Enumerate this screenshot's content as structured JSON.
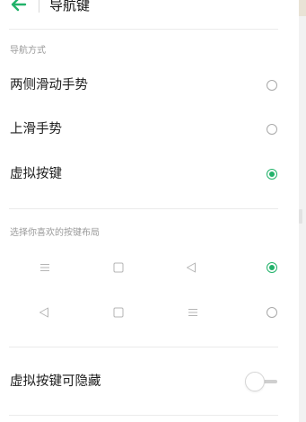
{
  "colors": {
    "accent": "#22b26a",
    "divider": "#ebebeb",
    "muted": "#9a9a9a"
  },
  "header": {
    "title": "导航键",
    "back_icon": "arrow-left-icon"
  },
  "navigation_mode": {
    "section_label": "导航方式",
    "options": [
      {
        "label": "两侧滑动手势",
        "selected": false
      },
      {
        "label": "上滑手势",
        "selected": false
      },
      {
        "label": "虚拟按键",
        "selected": true
      }
    ]
  },
  "layout": {
    "section_label": "选择你喜欢的按键布局",
    "options": [
      {
        "icons": [
          "menu-icon",
          "square-icon",
          "back-triangle-icon"
        ],
        "selected": true
      },
      {
        "icons": [
          "back-triangle-icon",
          "square-icon",
          "menu-icon"
        ],
        "selected": false
      }
    ]
  },
  "hide_keys": {
    "label": "虚拟按键可隐藏",
    "enabled": false
  }
}
